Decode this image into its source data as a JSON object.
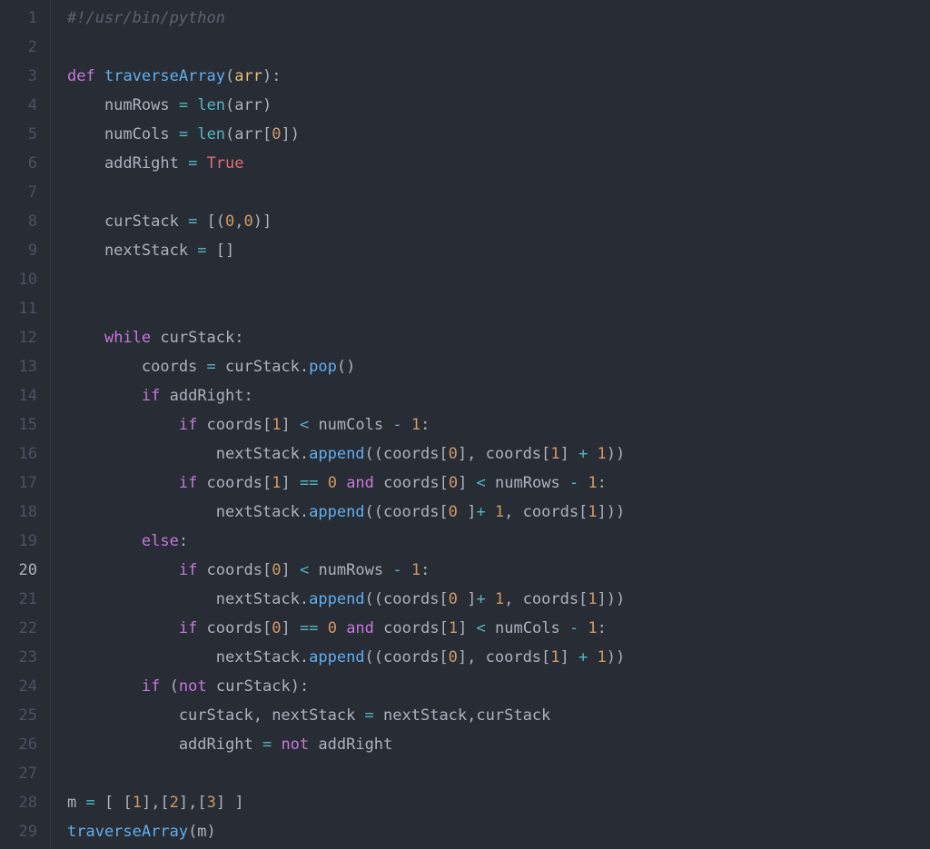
{
  "editor": {
    "language": "python",
    "current_line": 20,
    "lines": [
      {
        "no": 1,
        "tokens": [
          {
            "c": "cm",
            "t": "#!/usr/bin/python"
          }
        ]
      },
      {
        "no": 2,
        "tokens": []
      },
      {
        "no": 3,
        "tokens": [
          {
            "c": "kw",
            "t": "def"
          },
          {
            "c": "id",
            "t": " "
          },
          {
            "c": "fn",
            "t": "traverseArray"
          },
          {
            "c": "pu",
            "t": "("
          },
          {
            "c": "pr",
            "t": "arr"
          },
          {
            "c": "pu",
            "t": "):"
          }
        ]
      },
      {
        "no": 4,
        "tokens": [
          {
            "c": "id",
            "t": "    numRows "
          },
          {
            "c": "op",
            "t": "="
          },
          {
            "c": "id",
            "t": " "
          },
          {
            "c": "bi",
            "t": "len"
          },
          {
            "c": "pu",
            "t": "(arr)"
          }
        ]
      },
      {
        "no": 5,
        "tokens": [
          {
            "c": "id",
            "t": "    numCols "
          },
          {
            "c": "op",
            "t": "="
          },
          {
            "c": "id",
            "t": " "
          },
          {
            "c": "bi",
            "t": "len"
          },
          {
            "c": "pu",
            "t": "(arr["
          },
          {
            "c": "cn",
            "t": "0"
          },
          {
            "c": "pu",
            "t": "])"
          }
        ]
      },
      {
        "no": 6,
        "tokens": [
          {
            "c": "id",
            "t": "    addRight "
          },
          {
            "c": "op",
            "t": "="
          },
          {
            "c": "id",
            "t": " "
          },
          {
            "c": "tr",
            "t": "True"
          }
        ]
      },
      {
        "no": 7,
        "tokens": []
      },
      {
        "no": 8,
        "tokens": [
          {
            "c": "id",
            "t": "    curStack "
          },
          {
            "c": "op",
            "t": "="
          },
          {
            "c": "id",
            "t": " "
          },
          {
            "c": "pu",
            "t": "[("
          },
          {
            "c": "cn",
            "t": "0"
          },
          {
            "c": "pu",
            "t": ","
          },
          {
            "c": "cn",
            "t": "0"
          },
          {
            "c": "pu",
            "t": ")]"
          }
        ]
      },
      {
        "no": 9,
        "tokens": [
          {
            "c": "id",
            "t": "    nextStack "
          },
          {
            "c": "op",
            "t": "="
          },
          {
            "c": "id",
            "t": " "
          },
          {
            "c": "pu",
            "t": "[]"
          }
        ]
      },
      {
        "no": 10,
        "tokens": []
      },
      {
        "no": 11,
        "tokens": []
      },
      {
        "no": 12,
        "tokens": [
          {
            "c": "id",
            "t": "    "
          },
          {
            "c": "kw",
            "t": "while"
          },
          {
            "c": "id",
            "t": " curStack"
          },
          {
            "c": "pu",
            "t": ":"
          }
        ]
      },
      {
        "no": 13,
        "tokens": [
          {
            "c": "id",
            "t": "        coords "
          },
          {
            "c": "op",
            "t": "="
          },
          {
            "c": "id",
            "t": " curStack"
          },
          {
            "c": "pu",
            "t": "."
          },
          {
            "c": "fn",
            "t": "pop"
          },
          {
            "c": "pu",
            "t": "()"
          }
        ]
      },
      {
        "no": 14,
        "tokens": [
          {
            "c": "id",
            "t": "        "
          },
          {
            "c": "kw",
            "t": "if"
          },
          {
            "c": "id",
            "t": " addRight"
          },
          {
            "c": "pu",
            "t": ":"
          }
        ]
      },
      {
        "no": 15,
        "tokens": [
          {
            "c": "id",
            "t": "            "
          },
          {
            "c": "kw",
            "t": "if"
          },
          {
            "c": "id",
            "t": " coords"
          },
          {
            "c": "pu",
            "t": "["
          },
          {
            "c": "cn",
            "t": "1"
          },
          {
            "c": "pu",
            "t": "] "
          },
          {
            "c": "op",
            "t": "<"
          },
          {
            "c": "id",
            "t": " numCols "
          },
          {
            "c": "op",
            "t": "-"
          },
          {
            "c": "id",
            "t": " "
          },
          {
            "c": "cn",
            "t": "1"
          },
          {
            "c": "pu",
            "t": ":"
          }
        ]
      },
      {
        "no": 16,
        "tokens": [
          {
            "c": "id",
            "t": "                nextStack"
          },
          {
            "c": "pu",
            "t": "."
          },
          {
            "c": "fn",
            "t": "append"
          },
          {
            "c": "pu",
            "t": "((coords["
          },
          {
            "c": "cn",
            "t": "0"
          },
          {
            "c": "pu",
            "t": "], coords["
          },
          {
            "c": "cn",
            "t": "1"
          },
          {
            "c": "pu",
            "t": "] "
          },
          {
            "c": "op",
            "t": "+"
          },
          {
            "c": "id",
            "t": " "
          },
          {
            "c": "cn",
            "t": "1"
          },
          {
            "c": "pu",
            "t": "))"
          }
        ]
      },
      {
        "no": 17,
        "tokens": [
          {
            "c": "id",
            "t": "            "
          },
          {
            "c": "kw",
            "t": "if"
          },
          {
            "c": "id",
            "t": " coords"
          },
          {
            "c": "pu",
            "t": "["
          },
          {
            "c": "cn",
            "t": "1"
          },
          {
            "c": "pu",
            "t": "] "
          },
          {
            "c": "op",
            "t": "=="
          },
          {
            "c": "id",
            "t": " "
          },
          {
            "c": "cn",
            "t": "0"
          },
          {
            "c": "id",
            "t": " "
          },
          {
            "c": "kw",
            "t": "and"
          },
          {
            "c": "id",
            "t": " coords"
          },
          {
            "c": "pu",
            "t": "["
          },
          {
            "c": "cn",
            "t": "0"
          },
          {
            "c": "pu",
            "t": "] "
          },
          {
            "c": "op",
            "t": "<"
          },
          {
            "c": "id",
            "t": " numRows "
          },
          {
            "c": "op",
            "t": "-"
          },
          {
            "c": "id",
            "t": " "
          },
          {
            "c": "cn",
            "t": "1"
          },
          {
            "c": "pu",
            "t": ":"
          }
        ]
      },
      {
        "no": 18,
        "tokens": [
          {
            "c": "id",
            "t": "                nextStack"
          },
          {
            "c": "pu",
            "t": "."
          },
          {
            "c": "fn",
            "t": "append"
          },
          {
            "c": "pu",
            "t": "((coords["
          },
          {
            "c": "cn",
            "t": "0"
          },
          {
            "c": "id",
            "t": " "
          },
          {
            "c": "pu",
            "t": "]"
          },
          {
            "c": "op",
            "t": "+"
          },
          {
            "c": "id",
            "t": " "
          },
          {
            "c": "cn",
            "t": "1"
          },
          {
            "c": "pu",
            "t": ", coords["
          },
          {
            "c": "cn",
            "t": "1"
          },
          {
            "c": "pu",
            "t": "]))"
          }
        ]
      },
      {
        "no": 19,
        "tokens": [
          {
            "c": "id",
            "t": "        "
          },
          {
            "c": "kw",
            "t": "else"
          },
          {
            "c": "pu",
            "t": ":"
          }
        ]
      },
      {
        "no": 20,
        "tokens": [
          {
            "c": "id",
            "t": "            "
          },
          {
            "c": "kw",
            "t": "if"
          },
          {
            "c": "id",
            "t": " coords"
          },
          {
            "c": "pu",
            "t": "["
          },
          {
            "c": "cn",
            "t": "0"
          },
          {
            "c": "pu",
            "t": "] "
          },
          {
            "c": "op",
            "t": "<"
          },
          {
            "c": "id",
            "t": " numRows "
          },
          {
            "c": "op",
            "t": "-"
          },
          {
            "c": "id",
            "t": " "
          },
          {
            "c": "cn",
            "t": "1"
          },
          {
            "c": "pu",
            "t": ":"
          }
        ]
      },
      {
        "no": 21,
        "tokens": [
          {
            "c": "id",
            "t": "                nextStack"
          },
          {
            "c": "pu",
            "t": "."
          },
          {
            "c": "fn",
            "t": "append"
          },
          {
            "c": "pu",
            "t": "((coords["
          },
          {
            "c": "cn",
            "t": "0"
          },
          {
            "c": "id",
            "t": " "
          },
          {
            "c": "pu",
            "t": "]"
          },
          {
            "c": "op",
            "t": "+"
          },
          {
            "c": "id",
            "t": " "
          },
          {
            "c": "cn",
            "t": "1"
          },
          {
            "c": "pu",
            "t": ", coords["
          },
          {
            "c": "cn",
            "t": "1"
          },
          {
            "c": "pu",
            "t": "]))"
          }
        ]
      },
      {
        "no": 22,
        "tokens": [
          {
            "c": "id",
            "t": "            "
          },
          {
            "c": "kw",
            "t": "if"
          },
          {
            "c": "id",
            "t": " coords"
          },
          {
            "c": "pu",
            "t": "["
          },
          {
            "c": "cn",
            "t": "0"
          },
          {
            "c": "pu",
            "t": "] "
          },
          {
            "c": "op",
            "t": "=="
          },
          {
            "c": "id",
            "t": " "
          },
          {
            "c": "cn",
            "t": "0"
          },
          {
            "c": "id",
            "t": " "
          },
          {
            "c": "kw",
            "t": "and"
          },
          {
            "c": "id",
            "t": " coords"
          },
          {
            "c": "pu",
            "t": "["
          },
          {
            "c": "cn",
            "t": "1"
          },
          {
            "c": "pu",
            "t": "] "
          },
          {
            "c": "op",
            "t": "<"
          },
          {
            "c": "id",
            "t": " numCols "
          },
          {
            "c": "op",
            "t": "-"
          },
          {
            "c": "id",
            "t": " "
          },
          {
            "c": "cn",
            "t": "1"
          },
          {
            "c": "pu",
            "t": ":"
          }
        ]
      },
      {
        "no": 23,
        "tokens": [
          {
            "c": "id",
            "t": "                nextStack"
          },
          {
            "c": "pu",
            "t": "."
          },
          {
            "c": "fn",
            "t": "append"
          },
          {
            "c": "pu",
            "t": "((coords["
          },
          {
            "c": "cn",
            "t": "0"
          },
          {
            "c": "pu",
            "t": "], coords["
          },
          {
            "c": "cn",
            "t": "1"
          },
          {
            "c": "pu",
            "t": "] "
          },
          {
            "c": "op",
            "t": "+"
          },
          {
            "c": "id",
            "t": " "
          },
          {
            "c": "cn",
            "t": "1"
          },
          {
            "c": "pu",
            "t": "))"
          }
        ]
      },
      {
        "no": 24,
        "tokens": [
          {
            "c": "id",
            "t": "        "
          },
          {
            "c": "kw",
            "t": "if"
          },
          {
            "c": "id",
            "t": " "
          },
          {
            "c": "pu",
            "t": "("
          },
          {
            "c": "kw",
            "t": "not"
          },
          {
            "c": "id",
            "t": " curStack"
          },
          {
            "c": "pu",
            "t": "):"
          }
        ]
      },
      {
        "no": 25,
        "tokens": [
          {
            "c": "id",
            "t": "            curStack"
          },
          {
            "c": "pu",
            "t": ","
          },
          {
            "c": "id",
            "t": " nextStack "
          },
          {
            "c": "op",
            "t": "="
          },
          {
            "c": "id",
            "t": " nextStack"
          },
          {
            "c": "pu",
            "t": ","
          },
          {
            "c": "id",
            "t": "curStack"
          }
        ]
      },
      {
        "no": 26,
        "tokens": [
          {
            "c": "id",
            "t": "            addRight "
          },
          {
            "c": "op",
            "t": "="
          },
          {
            "c": "id",
            "t": " "
          },
          {
            "c": "kw",
            "t": "not"
          },
          {
            "c": "id",
            "t": " addRight"
          }
        ]
      },
      {
        "no": 27,
        "tokens": []
      },
      {
        "no": 28,
        "tokens": [
          {
            "c": "id",
            "t": "m "
          },
          {
            "c": "op",
            "t": "="
          },
          {
            "c": "id",
            "t": " "
          },
          {
            "c": "pu",
            "t": "[ ["
          },
          {
            "c": "cn",
            "t": "1"
          },
          {
            "c": "pu",
            "t": "],["
          },
          {
            "c": "cn",
            "t": "2"
          },
          {
            "c": "pu",
            "t": "],["
          },
          {
            "c": "cn",
            "t": "3"
          },
          {
            "c": "pu",
            "t": "] ]"
          }
        ]
      },
      {
        "no": 29,
        "tokens": [
          {
            "c": "fn",
            "t": "traverseArray"
          },
          {
            "c": "pu",
            "t": "(m)"
          }
        ]
      }
    ]
  }
}
